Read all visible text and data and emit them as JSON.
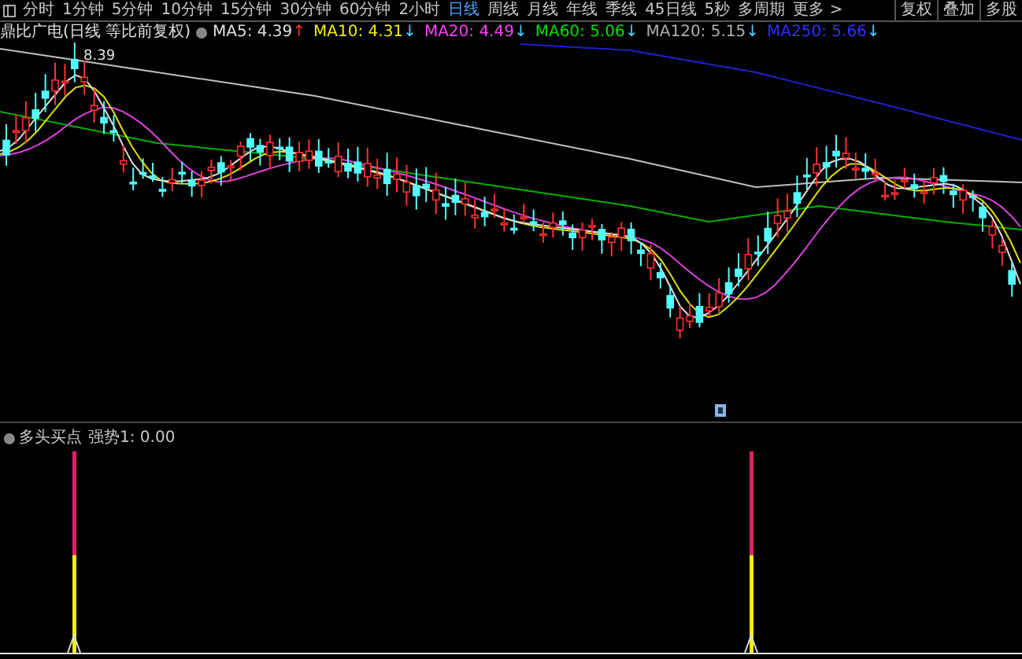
{
  "toolbar": {
    "periods": [
      {
        "label": "分时",
        "selected": false
      },
      {
        "label": "1分钟",
        "selected": false
      },
      {
        "label": "5分钟",
        "selected": false
      },
      {
        "label": "10分钟",
        "selected": false
      },
      {
        "label": "15分钟",
        "selected": false
      },
      {
        "label": "30分钟",
        "selected": false
      },
      {
        "label": "60分钟",
        "selected": false
      },
      {
        "label": "2小时",
        "selected": false
      },
      {
        "label": "日线",
        "selected": true
      },
      {
        "label": "周线",
        "selected": false
      },
      {
        "label": "月线",
        "selected": false
      },
      {
        "label": "年线",
        "selected": false
      },
      {
        "label": "季线",
        "selected": false
      },
      {
        "label": "45日线",
        "selected": false
      },
      {
        "label": "5秒",
        "selected": false
      },
      {
        "label": "多周期",
        "selected": false
      },
      {
        "label": "更多 >",
        "selected": false
      }
    ],
    "right_buttons": [
      "复权",
      "叠加",
      "多股"
    ]
  },
  "legend": {
    "title": "鼎比广电(日线 等比前复权)",
    "indicators": [
      {
        "name": "MA5:",
        "value": "4.39",
        "arrow": "↑",
        "rising": true,
        "color": "#e0e0e0"
      },
      {
        "name": "MA10:",
        "value": "4.31",
        "arrow": "↓",
        "rising": false,
        "color": "#f0f000"
      },
      {
        "name": "MA20:",
        "value": "4.49",
        "arrow": "↓",
        "rising": false,
        "color": "#ff40ff"
      },
      {
        "name": "MA60:",
        "value": "5.06",
        "arrow": "↓",
        "rising": false,
        "color": "#00e000"
      },
      {
        "name": "MA120:",
        "value": "5.15",
        "arrow": "↓",
        "rising": false,
        "color": "#b0b0b0"
      },
      {
        "name": "MA250:",
        "value": "5.66",
        "arrow": "↓",
        "rising": false,
        "color": "#3030ff"
      }
    ]
  },
  "chart": {
    "price_label": "8.39"
  },
  "indicator": {
    "title": "多头买点",
    "reading": "强势1: 0.00"
  }
}
